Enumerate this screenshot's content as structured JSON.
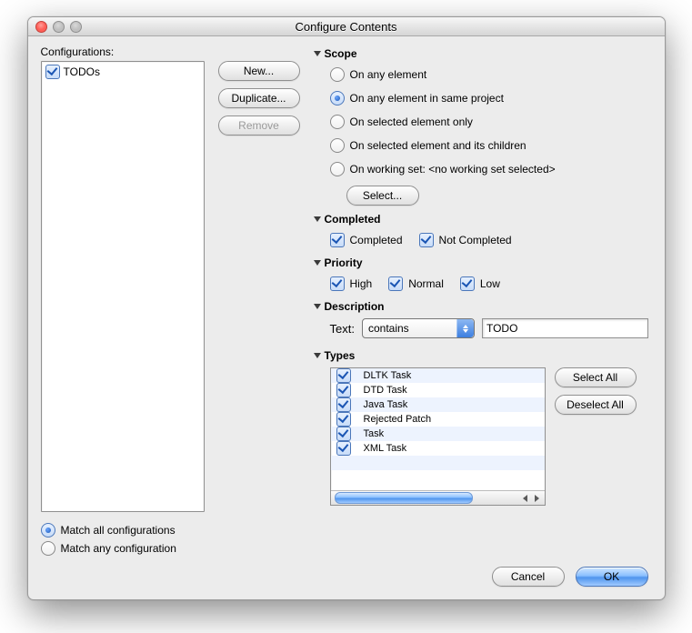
{
  "window": {
    "title": "Configure Contents"
  },
  "left": {
    "label": "Configurations:",
    "items": [
      {
        "label": "TODOs",
        "checked": true
      }
    ],
    "match_all": "Match all configurations",
    "match_any": "Match any configuration",
    "match_mode": "all"
  },
  "buttons": {
    "new": "New...",
    "duplicate": "Duplicate...",
    "remove": "Remove",
    "select": "Select...",
    "select_all": "Select All",
    "deselect_all": "Deselect All",
    "cancel": "Cancel",
    "ok": "OK"
  },
  "scope": {
    "header": "Scope",
    "options": {
      "any_element": "On any element",
      "same_project": "On any element in same project",
      "selected_only": "On selected element only",
      "selected_children": "On selected element and its children",
      "working_set_prefix": "On working set: ",
      "working_set_value": "<no working set selected>"
    },
    "selected": "same_project"
  },
  "completed": {
    "header": "Completed",
    "completed_label": "Completed",
    "not_completed_label": "Not Completed",
    "completed": true,
    "not_completed": true
  },
  "priority": {
    "header": "Priority",
    "high": "High",
    "normal": "Normal",
    "low": "Low",
    "high_checked": true,
    "normal_checked": true,
    "low_checked": true
  },
  "description": {
    "header": "Description",
    "text_label": "Text:",
    "operator": "contains",
    "value": "TODO"
  },
  "types": {
    "header": "Types",
    "items": [
      {
        "label": "DLTK Task",
        "checked": true
      },
      {
        "label": "DTD Task",
        "checked": true
      },
      {
        "label": "Java Task",
        "checked": true
      },
      {
        "label": "Rejected Patch",
        "checked": true
      },
      {
        "label": "Task",
        "checked": true
      },
      {
        "label": "XML Task",
        "checked": true
      }
    ]
  }
}
